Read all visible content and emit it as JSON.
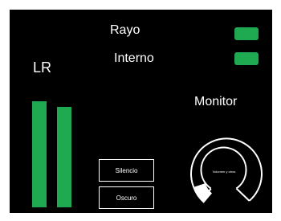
{
  "indicators": {
    "rayo": {
      "label": "Rayo",
      "color": "#1faa52"
    },
    "interno": {
      "label": "Interno",
      "color": "#1faa52"
    }
  },
  "meters": {
    "label": "LR",
    "left_level": 0.94,
    "right_level": 0.89,
    "color": "#1faa52"
  },
  "buttons": {
    "silencio": "Silencio",
    "oscuro": "Oscuro"
  },
  "monitor": {
    "label": "Monitor",
    "knob_label": "Volumen y otros",
    "level": 0.12,
    "fill_color": "#ffffff"
  },
  "colors": {
    "background": "#000000",
    "text": "#ffffff",
    "accent": "#1faa52"
  }
}
